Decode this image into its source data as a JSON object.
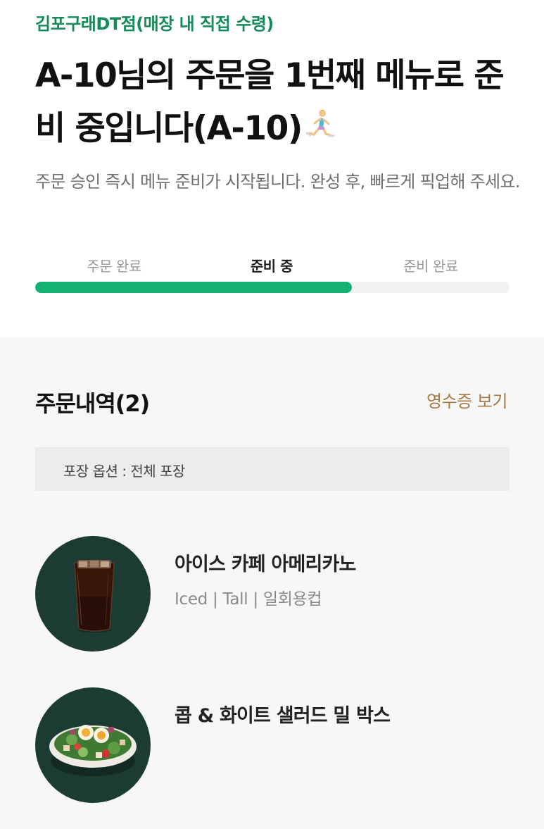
{
  "header": {
    "store_name": "김포구래DT점(매장 내 직접 수령)",
    "headline": "A-10님의 주문을 1번째 메뉴로 준비 중입니다(A-10)",
    "runner_icon": "person-running-icon",
    "description": "주문 승인 즉시 메뉴 준비가 시작됩니다. 완성 후, 빠르게 픽업해 주세요."
  },
  "progress": {
    "steps": [
      "주문 완료",
      "준비 중",
      "준비 완료"
    ],
    "active_step": 1,
    "fill_fraction": 0.667,
    "accent_color": "#13b273"
  },
  "order": {
    "title": "주문내역(2)",
    "receipt_label": "영수증 보기",
    "packaging_option": "포장 옵션 : 전체 포장",
    "items": [
      {
        "name": "아이스 카페 아메리카노",
        "options": "Iced | Tall | 일회용컵",
        "image_icon": "iced-americano-image"
      },
      {
        "name": "콥 & 화이트 샐러드 밀 박스",
        "options": "",
        "image_icon": "cobb-salad-image"
      }
    ]
  },
  "colors": {
    "store_green": "#138b5a",
    "receipt_brown": "#a47a44",
    "thumb_bg": "#1b3b33"
  }
}
